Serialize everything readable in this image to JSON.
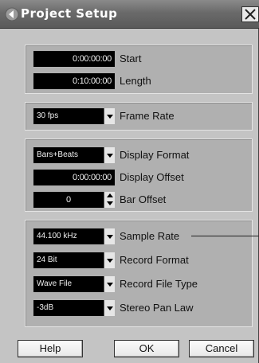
{
  "window": {
    "title": "Project Setup"
  },
  "timing": {
    "start_value": "0:00:00:00",
    "start_label": "Start",
    "length_value": "0:10:00:00",
    "length_label": "Length"
  },
  "frame": {
    "value": "30 fps",
    "label": "Frame Rate"
  },
  "display": {
    "format_value": "Bars+Beats",
    "format_label": "Display Format",
    "offset_value": "0:00:00:00",
    "offset_label": "Display Offset",
    "bar_offset_value": "0",
    "bar_offset_label": "Bar Offset"
  },
  "audio": {
    "sample_rate_value": "44.100 kHz",
    "sample_rate_label": "Sample Rate",
    "record_format_value": "24 Bit",
    "record_format_label": "Record Format",
    "file_type_value": "Wave File",
    "file_type_label": "Record File Type",
    "pan_law_value": "-3dB",
    "pan_law_label": "Stereo Pan Law"
  },
  "buttons": {
    "help": "Help",
    "ok": "OK",
    "cancel": "Cancel"
  },
  "icons": {
    "title_arrow": "left-arrow-icon",
    "close": "close-icon"
  }
}
